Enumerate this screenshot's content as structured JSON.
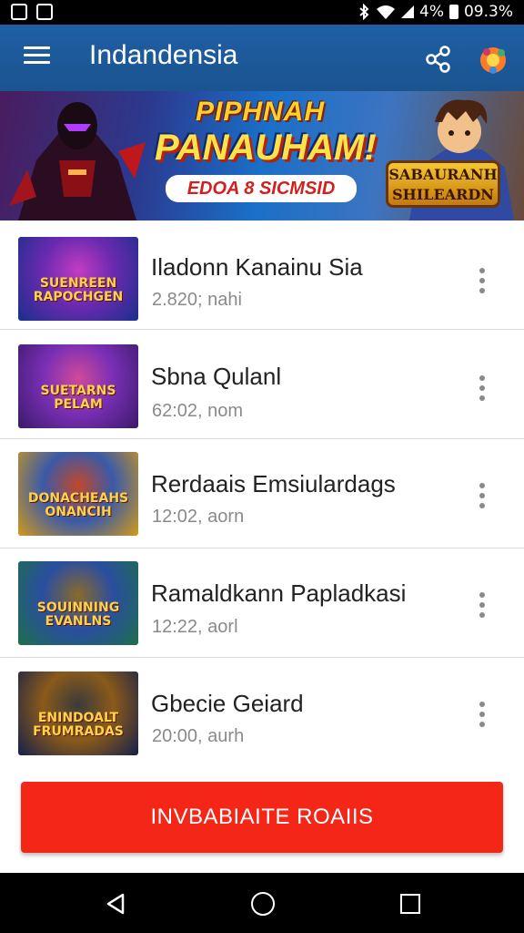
{
  "status_bar": {
    "battery_text": "4%",
    "time_text": "09.3%"
  },
  "app_bar": {
    "title": "Indandensia",
    "menu_icon": "hamburger-menu-icon",
    "share_icon": "share-icon",
    "avatar_icon": "avatar-icon"
  },
  "banner": {
    "headline": "PIPHNAH",
    "title": "PANAUHAM!",
    "subtitle": "EDOA 8 SICMSID",
    "badge": "SABAURANH SHILEARDN"
  },
  "list": {
    "items": [
      {
        "title": "Iladonn Kanainu Sia",
        "time": "2.820; nahi",
        "thumb_text": "SUENREEN RAPOCHGEN",
        "thumb_colors": [
          "#1a2f8a",
          "#6a2ab0",
          "#c33cc2"
        ]
      },
      {
        "title": "Sbna Qulanl",
        "time": "62:02, nom",
        "thumb_text": "SUETARNS PELAM",
        "thumb_colors": [
          "#3a1a6a",
          "#7a2fb5",
          "#d04a9a"
        ]
      },
      {
        "title": "Rerdaais Emsiulardags",
        "time": "12:02, aorn",
        "thumb_text": "DONACHEAHS ONANCIH",
        "thumb_colors": [
          "#d29a1a",
          "#3a5aa8",
          "#c2482a"
        ]
      },
      {
        "title": "Ramaldkann Papladkasi",
        "time": "12:22, aorl",
        "thumb_text": "SOUINNING EVANLNS",
        "thumb_colors": [
          "#1d6f4a",
          "#2a4ea0",
          "#8a6a2a"
        ]
      },
      {
        "title": "Gbecie Geiard",
        "time": "20:00, aurh",
        "thumb_text": "ENINDOALT FRUMRADAS",
        "thumb_colors": [
          "#14204a",
          "#8a5a1a",
          "#3a3a3a"
        ]
      }
    ],
    "more_icon": "more-vertical-icon"
  },
  "cta": {
    "label": "INVBABIAITE ROAIIS",
    "color": "#f42618"
  },
  "nav_bar": {
    "back_icon": "back-triangle-icon",
    "home_icon": "home-circle-icon",
    "recents_icon": "recents-square-icon"
  }
}
